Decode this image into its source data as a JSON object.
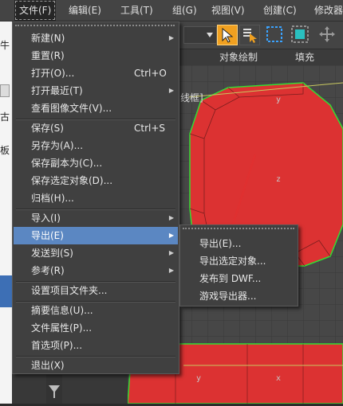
{
  "menubar": {
    "items": [
      "文件(F)",
      "编辑(E)",
      "工具(T)",
      "组(G)",
      "视图(V)",
      "创建(C)",
      "修改器"
    ]
  },
  "left_strip": {
    "texts": [
      "牛",
      "古",
      "板"
    ]
  },
  "ribbon": {
    "labels": [
      "对象绘制",
      "填充"
    ]
  },
  "viewport": {
    "label": "线框]",
    "axis_y_top": "y",
    "axis_z": "z",
    "axis_y_bottom": "y",
    "axis_x_bottom": "x",
    "mesh_color": "#dc3232",
    "edge_color": "#33dd33"
  },
  "file_menu": {
    "items": [
      {
        "label": "新建(N)",
        "shortcut": "",
        "arrow": "▶"
      },
      {
        "label": "重置(R)",
        "shortcut": "",
        "arrow": ""
      },
      {
        "label": "打开(O)...",
        "shortcut": "Ctrl+O",
        "arrow": ""
      },
      {
        "label": "打开最近(T)",
        "shortcut": "",
        "arrow": "▶"
      },
      {
        "label": "查看图像文件(V)...",
        "shortcut": "",
        "arrow": ""
      },
      {
        "label": "保存(S)",
        "shortcut": "Ctrl+S",
        "arrow": ""
      },
      {
        "label": "另存为(A)...",
        "shortcut": "",
        "arrow": ""
      },
      {
        "label": "保存副本为(C)...",
        "shortcut": "",
        "arrow": ""
      },
      {
        "label": "保存选定对象(D)...",
        "shortcut": "",
        "arrow": ""
      },
      {
        "label": "归档(H)...",
        "shortcut": "",
        "arrow": ""
      },
      {
        "label": "导入(I)",
        "shortcut": "",
        "arrow": "▶"
      },
      {
        "label": "导出(E)",
        "shortcut": "",
        "arrow": "▶"
      },
      {
        "label": "发送到(S)",
        "shortcut": "",
        "arrow": "▶"
      },
      {
        "label": "参考(R)",
        "shortcut": "",
        "arrow": "▶"
      },
      {
        "label": "设置项目文件夹...",
        "shortcut": "",
        "arrow": ""
      },
      {
        "label": "摘要信息(U)...",
        "shortcut": "",
        "arrow": ""
      },
      {
        "label": "文件属性(P)...",
        "shortcut": "",
        "arrow": ""
      },
      {
        "label": "首选项(P)...",
        "shortcut": "",
        "arrow": ""
      },
      {
        "label": "退出(X)",
        "shortcut": "",
        "arrow": ""
      }
    ]
  },
  "export_submenu": {
    "items": [
      "导出(E)...",
      "导出选定对象...",
      "发布到 DWF...",
      "游戏导出器..."
    ]
  },
  "colors": {
    "highlight": "#5b87c2",
    "menu_bg": "#404040",
    "arrow_annotation": "#e03030"
  }
}
